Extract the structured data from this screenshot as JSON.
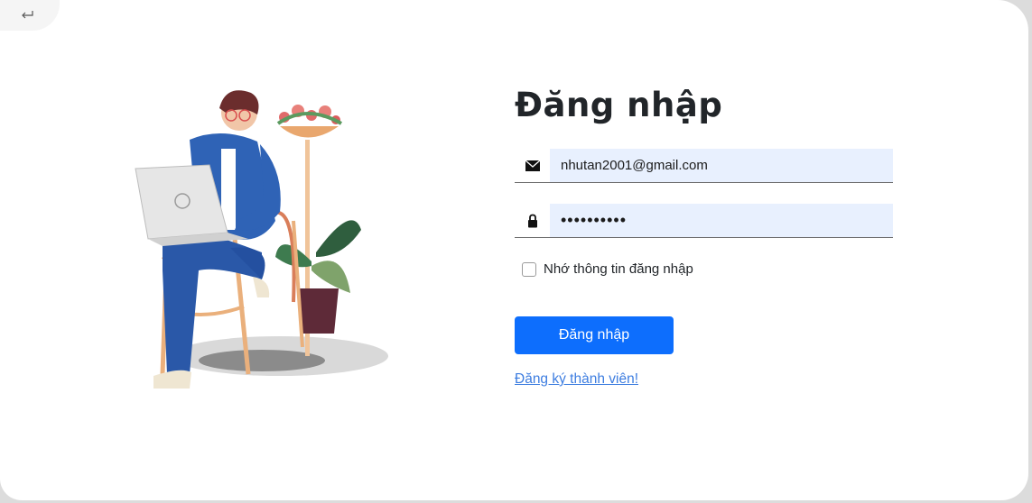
{
  "colors": {
    "primary": "#0d6efd",
    "link": "#3d7de0",
    "input_fill": "#e8f0fe",
    "title": "#212529"
  },
  "back": {
    "icon": "return-arrow-icon"
  },
  "login": {
    "title": "Đăng nhập",
    "email": {
      "value": "nhutan2001@gmail.com",
      "icon": "envelope-icon"
    },
    "password": {
      "value": "nhutan2001",
      "icon": "lock-icon"
    },
    "remember_label": "Nhớ thông tin đăng nhập",
    "remember_checked": false,
    "submit_label": "Đăng nhập",
    "register_link": "Đăng ký thành viên!"
  }
}
